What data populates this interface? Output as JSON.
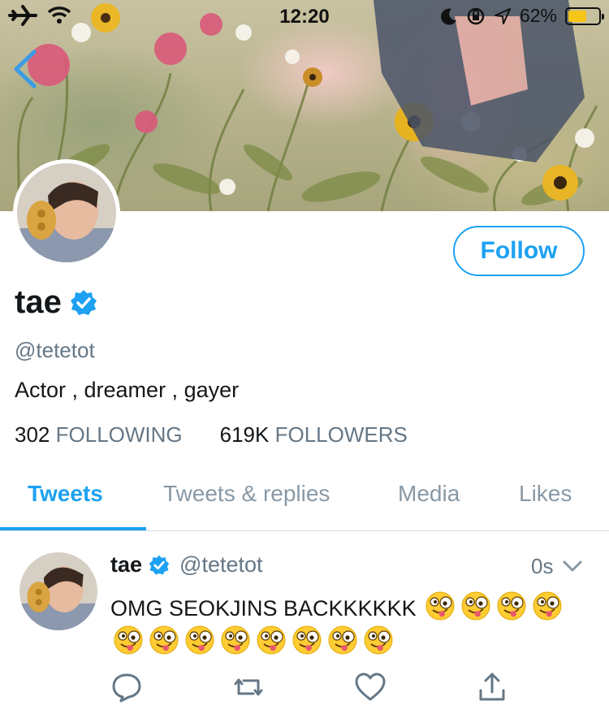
{
  "status_bar": {
    "time": "12:20",
    "battery_percent": "62%",
    "battery_level": 0.62
  },
  "profile": {
    "display_name": "tae",
    "handle": "@tetetot",
    "bio": "Actor , dreamer , gayer",
    "following_count": "302",
    "following_label": "FOLLOWING",
    "followers_count": "619K",
    "followers_label": "FOLLOWERS",
    "follow_label": "Follow",
    "verified": true
  },
  "tabs": [
    {
      "label": "Tweets",
      "active": true
    },
    {
      "label": "Tweets & replies",
      "active": false
    },
    {
      "label": "Media",
      "active": false
    },
    {
      "label": "Likes",
      "active": false
    }
  ],
  "tweet": {
    "name": "tae",
    "handle": "@tetetot",
    "time": "0s",
    "text": "OMG SEOKJINS BACKKKKKK",
    "emoji_count": 12,
    "emoji_name": "zany-face-emoji"
  },
  "actions": [
    "reply-icon",
    "retweet-icon",
    "like-icon",
    "share-icon"
  ],
  "colors": {
    "accent": "#1da1f2",
    "secondary_text": "#657786",
    "primary_text": "#14171a"
  }
}
